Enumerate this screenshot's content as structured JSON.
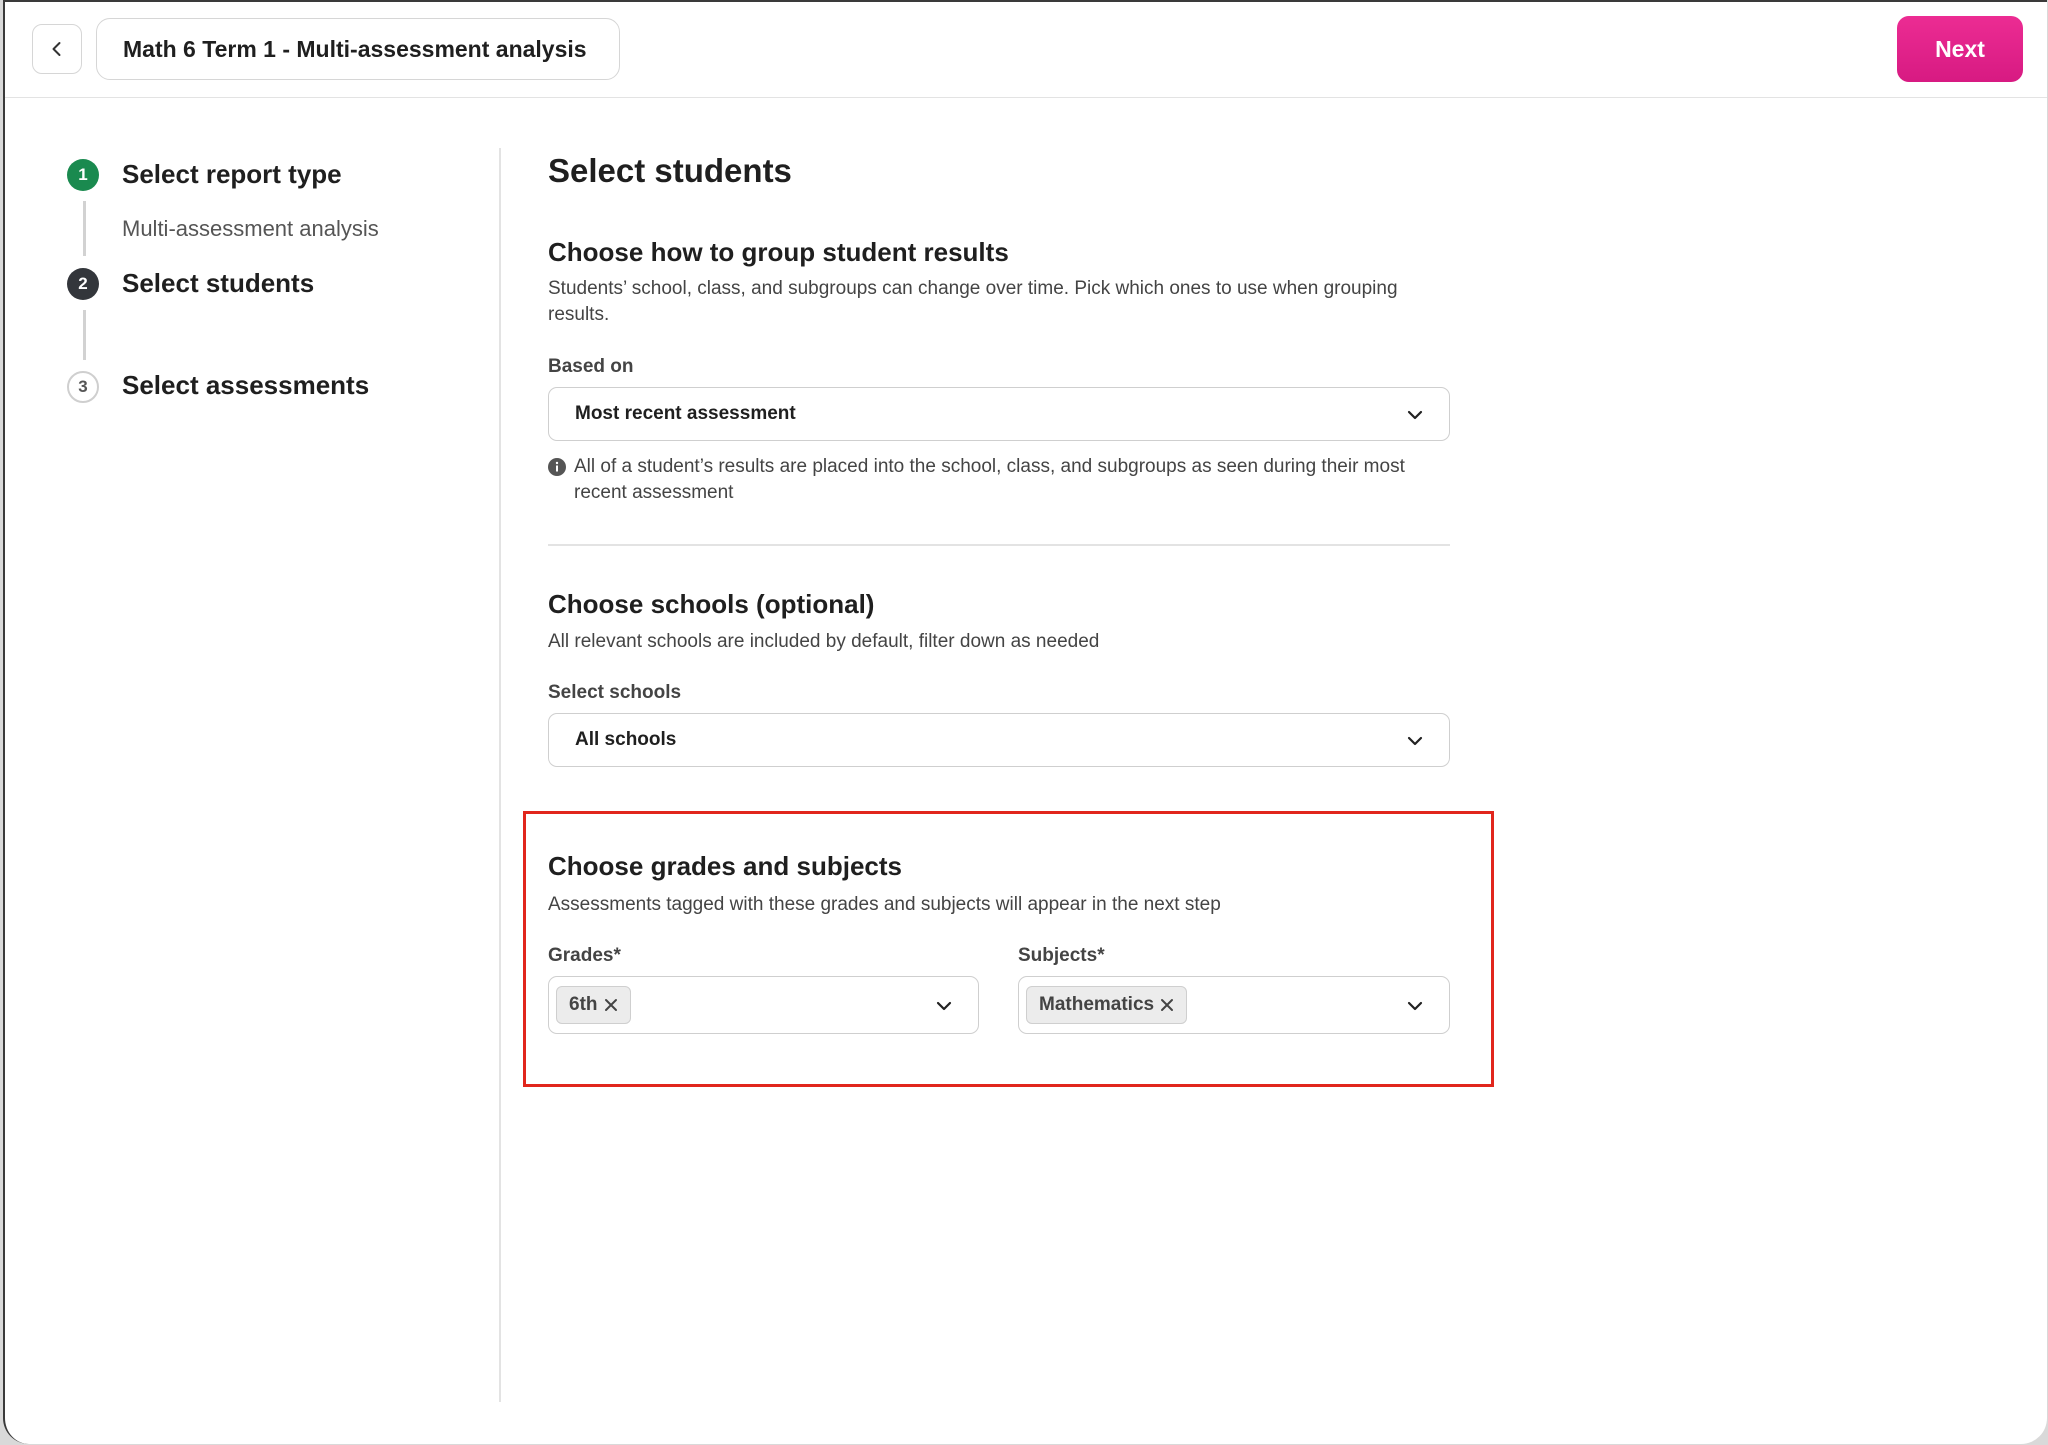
{
  "header": {
    "title": "Math 6 Term 1 - Multi-assessment analysis",
    "next_label": "Next",
    "accent_color": "#e0238a"
  },
  "stepper": {
    "steps": [
      {
        "number": "1",
        "label": "Select report type",
        "sublabel": "Multi-assessment analysis",
        "state": "complete"
      },
      {
        "number": "2",
        "label": "Select students",
        "state": "current"
      },
      {
        "number": "3",
        "label": "Select assessments",
        "state": "upcoming"
      }
    ]
  },
  "main": {
    "title": "Select students",
    "grouping": {
      "heading": "Choose how to group student results",
      "description": "Students’ school, class, and subgroups can change over time. Pick which ones to use when grouping results.",
      "field_label": "Based on",
      "selected": "Most recent assessment",
      "info": "All of a student’s results are placed into the school, class, and subgroups as seen during their most recent assessment"
    },
    "schools": {
      "heading": "Choose schools (optional)",
      "description": "All relevant schools are included by default, filter down as needed",
      "field_label": "Select schools",
      "selected": "All schools"
    },
    "grades_subjects": {
      "heading": "Choose grades and subjects",
      "description": "Assessments tagged with these grades and subjects will appear in the next step",
      "grades_label": "Grades*",
      "grades_selected": [
        "6th"
      ],
      "subjects_label": "Subjects*",
      "subjects_selected": [
        "Mathematics"
      ]
    }
  },
  "colors": {
    "step_complete": "#1a8a4f",
    "step_current": "#33363b",
    "highlight": "#e1261c"
  }
}
